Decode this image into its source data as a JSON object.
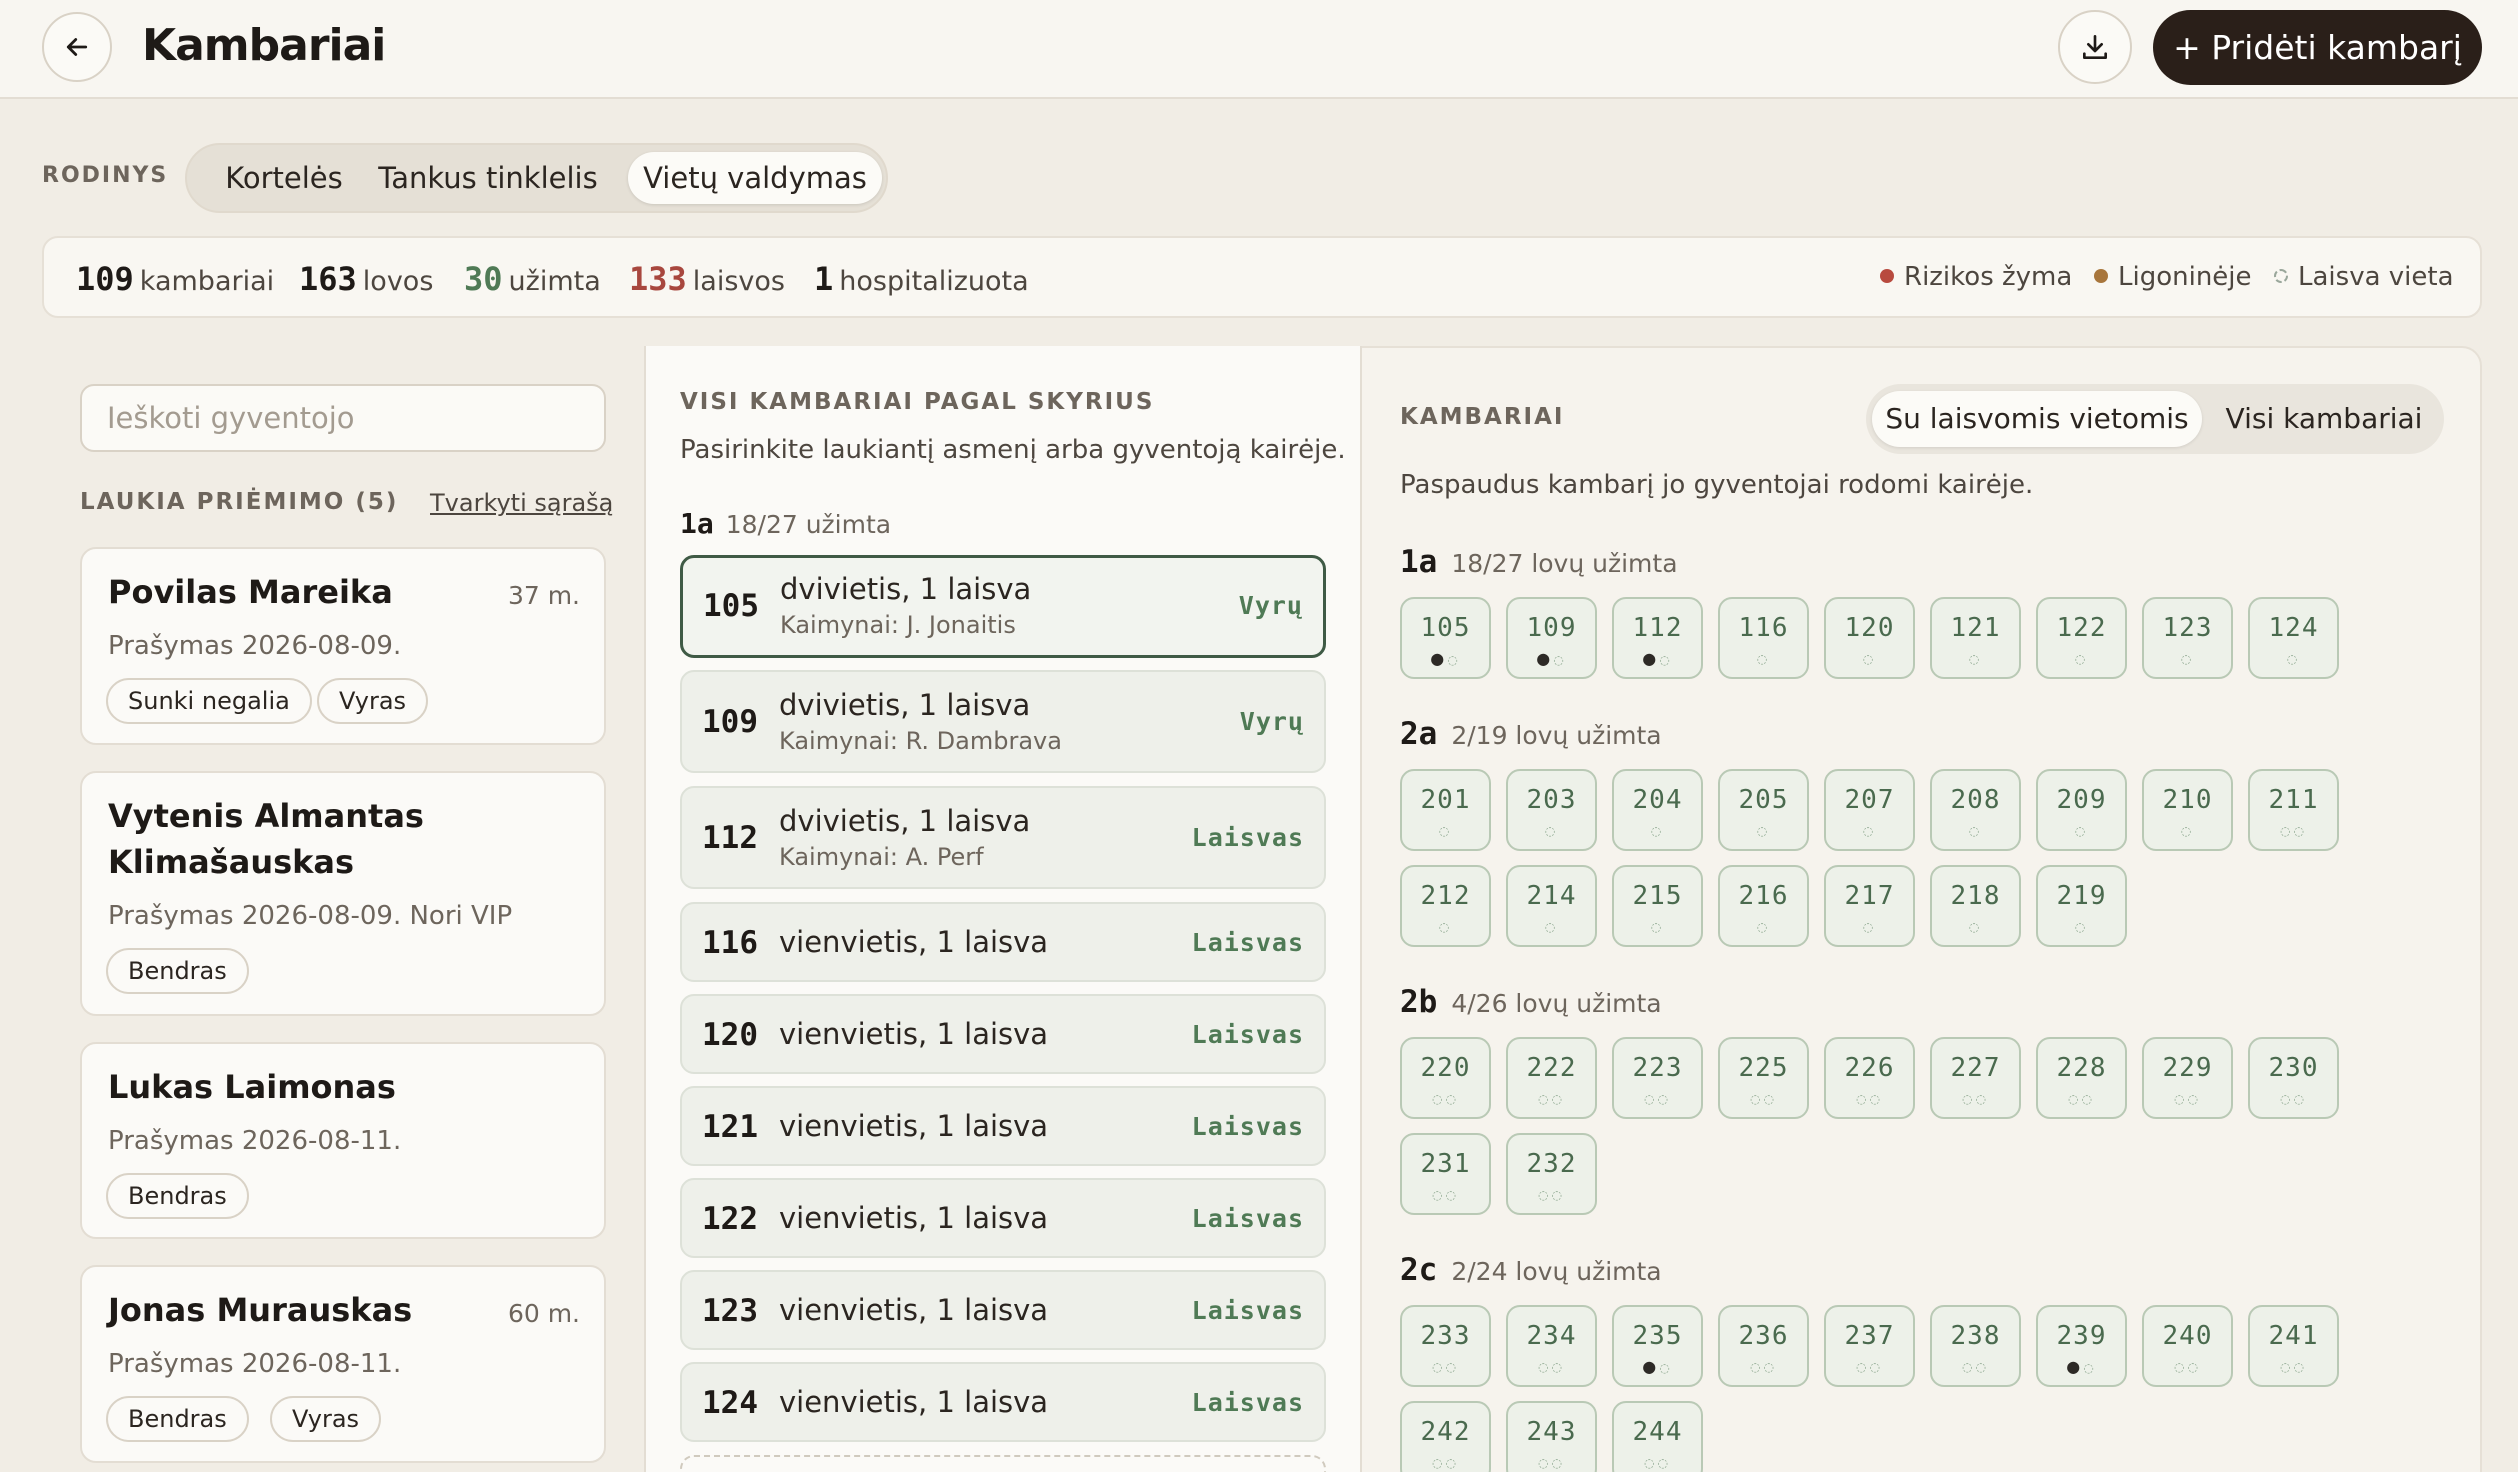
{
  "header": {
    "title": "Kambariai",
    "add_label": "+ Pridėti kambarį"
  },
  "view": {
    "label": "RODINYS",
    "tabs": [
      "Kortelės",
      "Tankus tinklelis",
      "Vietų valdymas"
    ],
    "active": "Vietų valdymas"
  },
  "stats": {
    "rooms_n": "109",
    "rooms_l": "kambariai",
    "beds_n": "163",
    "beds_l": "lovos",
    "occ_n": "30",
    "occ_l": "užimta",
    "free_n": "133",
    "free_l": "laisvos",
    "hosp_n": "1",
    "hosp_l": "hospitalizuota"
  },
  "legend": {
    "risk": "Rizikos žyma",
    "hospital": "Ligoninėje",
    "free": "Laisva vieta",
    "colors": {
      "risk": "#b84a3e",
      "hospital": "#a8763c",
      "free": "#9aa79b"
    }
  },
  "left": {
    "search_placeholder": "Ieškoti gyventojo",
    "waiting_label": "LAUKIA PRIĖMIMO (5)",
    "manage_link": "Tvarkyti sąrašą",
    "people": [
      {
        "name": "Povilas Mareika",
        "age": "37 m.",
        "req": "Prašymas 2026-08-09.",
        "tags": [
          "Sunki negalia",
          "Vyras"
        ]
      },
      {
        "name": "Vytenis Almantas Klimašauskas",
        "age": "",
        "req": "Prašymas 2026-08-09. Nori VIP",
        "tags": [
          "Bendras"
        ]
      },
      {
        "name": "Lukas Laimonas",
        "age": "",
        "req": "Prašymas 2026-08-11.",
        "tags": [
          "Bendras"
        ]
      },
      {
        "name": "Jonas Murauskas",
        "age": "60 m.",
        "req": "Prašymas 2026-08-11.",
        "tags": [
          "Bendras",
          "Vyras"
        ]
      }
    ]
  },
  "middle": {
    "heading": "VISI KAMBARIAI PAGAL SKYRIUS",
    "hint": "Pasirinkite laukiantį asmenį arba gyventoją kairėje.",
    "section": {
      "code": "1a",
      "occ": "18/27 užimta"
    },
    "rooms": [
      {
        "num": "105",
        "type": "dvivietis, 1 laisva",
        "neighbors": "Kaimynai: J. Jonaitis",
        "status": "Vyrų"
      },
      {
        "num": "109",
        "type": "dvivietis, 1 laisva",
        "neighbors": "Kaimynai: R. Dambrava",
        "status": "Vyrų"
      },
      {
        "num": "112",
        "type": "dvivietis, 1 laisva",
        "neighbors": "Kaimynai: A. Perf",
        "status": "Laisvas"
      },
      {
        "num": "116",
        "type": "vienvietis, 1 laisva",
        "neighbors": "",
        "status": "Laisvas"
      },
      {
        "num": "120",
        "type": "vienvietis, 1 laisva",
        "neighbors": "",
        "status": "Laisvas"
      },
      {
        "num": "121",
        "type": "vienvietis, 1 laisva",
        "neighbors": "",
        "status": "Laisvas"
      },
      {
        "num": "122",
        "type": "vienvietis, 1 laisva",
        "neighbors": "",
        "status": "Laisvas"
      },
      {
        "num": "123",
        "type": "vienvietis, 1 laisva",
        "neighbors": "",
        "status": "Laisvas"
      },
      {
        "num": "124",
        "type": "vienvietis, 1 laisva",
        "neighbors": "",
        "status": "Laisvas"
      }
    ]
  },
  "right": {
    "heading": "KAMBARIAI",
    "toggle": [
      "Su laisvomis vietomis",
      "Visi kambariai"
    ],
    "toggle_active": "Su laisvomis vietomis",
    "hint": "Paspaudus kambarį jo gyventojai rodomi kairėje.",
    "groups": [
      {
        "code": "1a",
        "occ": "18/27 lovų užimta",
        "rooms": [
          {
            "n": "105",
            "occ": 1,
            "free": 1
          },
          {
            "n": "109",
            "occ": 1,
            "free": 1
          },
          {
            "n": "112",
            "occ": 1,
            "free": 1
          },
          {
            "n": "116",
            "occ": 0,
            "free": 1
          },
          {
            "n": "120",
            "occ": 0,
            "free": 1
          },
          {
            "n": "121",
            "occ": 0,
            "free": 1
          },
          {
            "n": "122",
            "occ": 0,
            "free": 1
          },
          {
            "n": "123",
            "occ": 0,
            "free": 1
          },
          {
            "n": "124",
            "occ": 0,
            "free": 1
          }
        ]
      },
      {
        "code": "2a",
        "occ": "2/19 lovų užimta",
        "rooms": [
          {
            "n": "201",
            "occ": 0,
            "free": 1
          },
          {
            "n": "203",
            "occ": 0,
            "free": 1
          },
          {
            "n": "204",
            "occ": 0,
            "free": 1
          },
          {
            "n": "205",
            "occ": 0,
            "free": 1
          },
          {
            "n": "207",
            "occ": 0,
            "free": 1
          },
          {
            "n": "208",
            "occ": 0,
            "free": 1
          },
          {
            "n": "209",
            "occ": 0,
            "free": 1
          },
          {
            "n": "210",
            "occ": 0,
            "free": 1
          },
          {
            "n": "211",
            "occ": 0,
            "free": 2
          },
          {
            "n": "212",
            "occ": 0,
            "free": 1
          },
          {
            "n": "214",
            "occ": 0,
            "free": 1
          },
          {
            "n": "215",
            "occ": 0,
            "free": 1
          },
          {
            "n": "216",
            "occ": 0,
            "free": 1
          },
          {
            "n": "217",
            "occ": 0,
            "free": 1
          },
          {
            "n": "218",
            "occ": 0,
            "free": 1
          },
          {
            "n": "219",
            "occ": 0,
            "free": 1
          }
        ]
      },
      {
        "code": "2b",
        "occ": "4/26 lovų užimta",
        "rooms": [
          {
            "n": "220",
            "occ": 0,
            "free": 2
          },
          {
            "n": "222",
            "occ": 0,
            "free": 2
          },
          {
            "n": "223",
            "occ": 0,
            "free": 2
          },
          {
            "n": "225",
            "occ": 0,
            "free": 2
          },
          {
            "n": "226",
            "occ": 0,
            "free": 2
          },
          {
            "n": "227",
            "occ": 0,
            "free": 2
          },
          {
            "n": "228",
            "occ": 0,
            "free": 2
          },
          {
            "n": "229",
            "occ": 0,
            "free": 2
          },
          {
            "n": "230",
            "occ": 0,
            "free": 2
          },
          {
            "n": "231",
            "occ": 0,
            "free": 2
          },
          {
            "n": "232",
            "occ": 0,
            "free": 2
          }
        ]
      },
      {
        "code": "2c",
        "occ": "2/24 lovų užimta",
        "rooms": [
          {
            "n": "233",
            "occ": 0,
            "free": 2
          },
          {
            "n": "234",
            "occ": 0,
            "free": 2
          },
          {
            "n": "235",
            "occ": 1,
            "free": 1
          },
          {
            "n": "236",
            "occ": 0,
            "free": 2
          },
          {
            "n": "237",
            "occ": 0,
            "free": 2
          },
          {
            "n": "238",
            "occ": 0,
            "free": 2
          },
          {
            "n": "239",
            "occ": 1,
            "free": 1
          },
          {
            "n": "240",
            "occ": 0,
            "free": 2
          },
          {
            "n": "241",
            "occ": 0,
            "free": 2
          },
          {
            "n": "242",
            "occ": 0,
            "free": 2
          },
          {
            "n": "243",
            "occ": 0,
            "free": 2
          },
          {
            "n": "244",
            "occ": 0,
            "free": 2
          }
        ]
      }
    ]
  }
}
